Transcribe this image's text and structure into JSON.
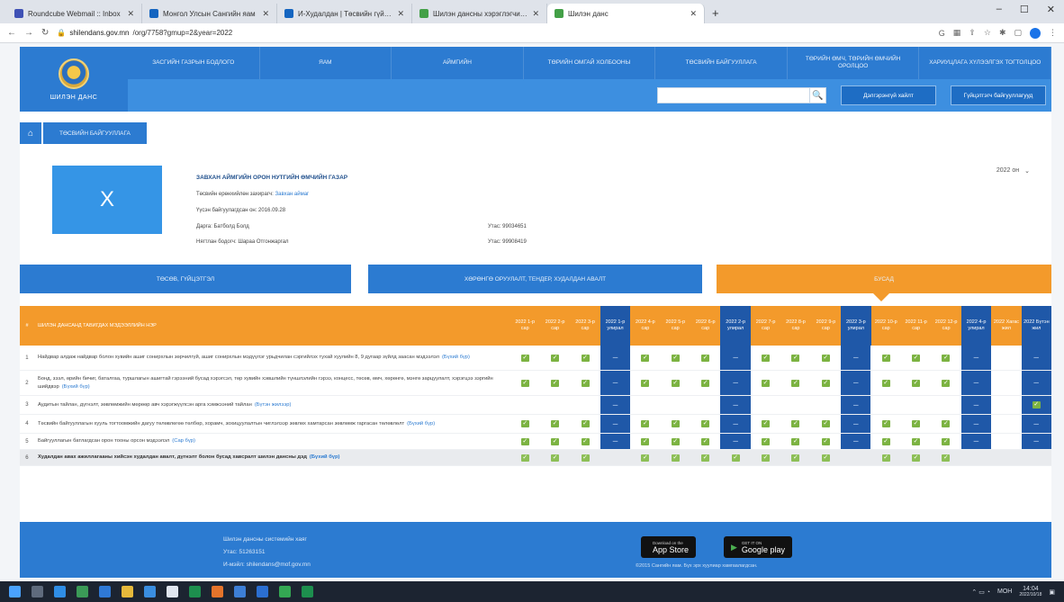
{
  "browser": {
    "tabs": [
      {
        "title": "Roundcube Webmail :: Inbox",
        "color": "#3f51b5"
      },
      {
        "title": "Монгол Улсын Сангийн яам",
        "color": "#1565c0"
      },
      {
        "title": "И-Худалдан | Төсвийн гүйцэтгэл",
        "color": "#1565c0"
      },
      {
        "title": "Шилэн дансны хэрэглэгчийн",
        "color": "#43a047"
      },
      {
        "title": "Шилэн данс",
        "color": "#43a047",
        "active": true
      }
    ],
    "url_host": "shilendans.gov.mn",
    "url_path": "/org/7758?gmup=2&year=2022",
    "window_controls": {
      "minimize": "–",
      "maximize": "☐",
      "close": "✕"
    },
    "new_tab": "+"
  },
  "header": {
    "logo_text": "ШИЛЭН ДАНС",
    "nav": [
      "Засгийн газрын бодлого",
      "ЯАМ",
      "АЙМГИЙН",
      "ТӨРИЙН ОМГАЙ ХОЛБООНЫ",
      "ТӨСВИЙН БАЙГУУЛЛАГА",
      "ТӨРИЙН ӨМЧ, ТӨРИЙН ӨМЧИЙН ОРОЛЦОО",
      "ХАРИУЦЛАГА ХҮЛЭЭЛГЭХ ТОГТОЛЦОО"
    ],
    "search_placeholder": "",
    "search_icon": "🔍",
    "btn_login": "Дэлгэрэнгүй хайлт",
    "btn_orgs": "Гүйцэтгэгч байгууллагууд"
  },
  "breadcrumb": {
    "home_icon": "⌂",
    "item": "ТӨСВИЙН БАЙГУУЛЛАГА"
  },
  "org": {
    "avatar_letter": "X",
    "name": "ЗАВХАН АЙМГИЙН ОРОН НУТГИЙН ӨМЧИЙН ГАЗАР",
    "parent_label": "Төсвийн ерөнхийлөн захирагч:",
    "parent_value": "Завхан аймаг",
    "founded": "Үүсэн байгуулагдсан он: 2016.09.28",
    "director": "Дарга: Батболд Болд",
    "director_phone": "Утас: 99034651",
    "accountant": "Нягтлан бодогч: Шараа Отгонжаргал",
    "accountant_phone": "Утас: 99908419",
    "year": "2022 он",
    "year_caret": "⌄"
  },
  "sections": [
    {
      "label": "ТӨСӨВ, ГҮЙЦЭТГЭЛ",
      "color": "blue"
    },
    {
      "label": "ХӨРӨНГӨ ОРУУЛАЛТ, ТЕНДЕР, ХУДАЛДАН АВАЛТ",
      "color": "blue"
    },
    {
      "label": "БУСАД",
      "color": "orange"
    }
  ],
  "table": {
    "num_header": "#",
    "name_header": "Шилэн дансанд тавигдах мэдээллийн нэр",
    "columns": [
      {
        "label": "2022 1-р сар",
        "type": "month"
      },
      {
        "label": "2022 2-р сар",
        "type": "month"
      },
      {
        "label": "2022 3-р сар",
        "type": "month"
      },
      {
        "label": "2022 1-р улирал",
        "type": "quarter"
      },
      {
        "label": "2022 4-р сар",
        "type": "month"
      },
      {
        "label": "2022 5-р сар",
        "type": "month"
      },
      {
        "label": "2022 6-р сар",
        "type": "month"
      },
      {
        "label": "2022 2-р улирал",
        "type": "quarter"
      },
      {
        "label": "2022 7-р сар",
        "type": "month"
      },
      {
        "label": "2022 8-р сар",
        "type": "month"
      },
      {
        "label": "2022 9-р сар",
        "type": "month"
      },
      {
        "label": "2022 3-р улирал",
        "type": "quarter"
      },
      {
        "label": "2022 10-р сар",
        "type": "month"
      },
      {
        "label": "2022 11-р сар",
        "type": "month"
      },
      {
        "label": "2022 12-р сар",
        "type": "month"
      },
      {
        "label": "2022 4-р улирал",
        "type": "quarter"
      },
      {
        "label": "2022 Хагас жил",
        "type": "month"
      },
      {
        "label": "2022 Бүтэн жил",
        "type": "quarter"
      }
    ],
    "rows": [
      {
        "num": "1",
        "name": "Найдвар алдаж найдвар болон хувийн ашиг сонирхлын зөрчилгүй, ашиг сонирхлын мэдүүлэг урьдчилан сэргийлэх тухай хуулийн 8, 9 дугаар зүйлд заасан мэдээлэл",
        "source": "(Бүхий бүр)",
        "cells": [
          "c",
          "c",
          "c",
          "q",
          "c",
          "c",
          "c",
          "q",
          "c",
          "c",
          "c",
          "q",
          "c",
          "c",
          "c",
          "q",
          "",
          "q"
        ]
      },
      {
        "num": "2",
        "name": "Бонд, зээл, өрийн бичиг, баталгаа, туршлагын ашигтай гэрээний бусад хэрэгсэл, төр хувийн хэвшлийн түншлэлийн гэрээ, концесс, төсөв, өмч, хөрөнгө, мэнгө зарцуулалт, хэрэгцээ зэргийн шийдвэр",
        "source": "(Бүхий бүр)",
        "cells": [
          "c",
          "c",
          "c",
          "q",
          "c",
          "c",
          "c",
          "q",
          "c",
          "c",
          "c",
          "q",
          "c",
          "c",
          "c",
          "q",
          "",
          "q"
        ]
      },
      {
        "num": "3",
        "name": "Аудитын тайлан, дүгнэлт, зөвлөмжийн мөрөөр авч хэрэгжүүлсэн арга хэмжээний тайлан",
        "source": "(Бүтэн жилээр)",
        "cells": [
          "",
          "",
          "",
          "q",
          "",
          "",
          "",
          "q",
          "",
          "",
          "",
          "q",
          "",
          "",
          "",
          "q",
          "",
          "c"
        ]
      },
      {
        "num": "4",
        "name": "Төсвийн байгууллагын хууль тогтоомжийн дагуу төлөвлөгөө төлбөр, хорамч, зохицуулалтын чиглэлээр зөвлөх хамтарсан зөвлөмж гаргасан төлөвлөлт",
        "source": "(Бүхий бүр)",
        "cells": [
          "c",
          "c",
          "c",
          "q",
          "c",
          "c",
          "c",
          "q",
          "c",
          "c",
          "c",
          "q",
          "c",
          "c",
          "c",
          "q",
          "",
          "q"
        ]
      },
      {
        "num": "5",
        "name": "Байгууллагын батлагдсан орон тооны орсон мэдээлэл",
        "source": "(Сар бүр)",
        "cells": [
          "c",
          "c",
          "c",
          "q",
          "c",
          "c",
          "c",
          "q",
          "c",
          "c",
          "c",
          "q",
          "c",
          "c",
          "c",
          "q",
          "",
          "q"
        ]
      },
      {
        "num": "6",
        "name": "Худалдан авах ажиллагааны хийсэн худалдан авалт, дүгнэлт болон бусад хавсралт шилэн дансны дэд",
        "source": "(Бүхий бүр)",
        "total": true,
        "cells": [
          "c",
          "c",
          "c",
          "",
          "c",
          "c",
          "c",
          "c",
          "c",
          "c",
          "c",
          "",
          "c",
          "c",
          "c",
          "",
          "",
          ""
        ]
      }
    ],
    "check_glyph": "✓",
    "dash_glyph": "–"
  },
  "footer": {
    "title": "Шилэн дансны системийн хаяг",
    "phone": "Утас: 51263151",
    "email": "И-мэйл: shilendans@mof.gov.mn",
    "appstore_small": "Download on the",
    "appstore_big": "App Store",
    "gplay_small": "GET IT ON",
    "gplay_big": "Google play",
    "copyright": "©2015 Сангийн яам. Бүх эрх хуулиар хамгаалагдсан."
  },
  "taskbar": {
    "tray_lang": "МОН",
    "time": "14:04",
    "date": "2022/10/18"
  }
}
